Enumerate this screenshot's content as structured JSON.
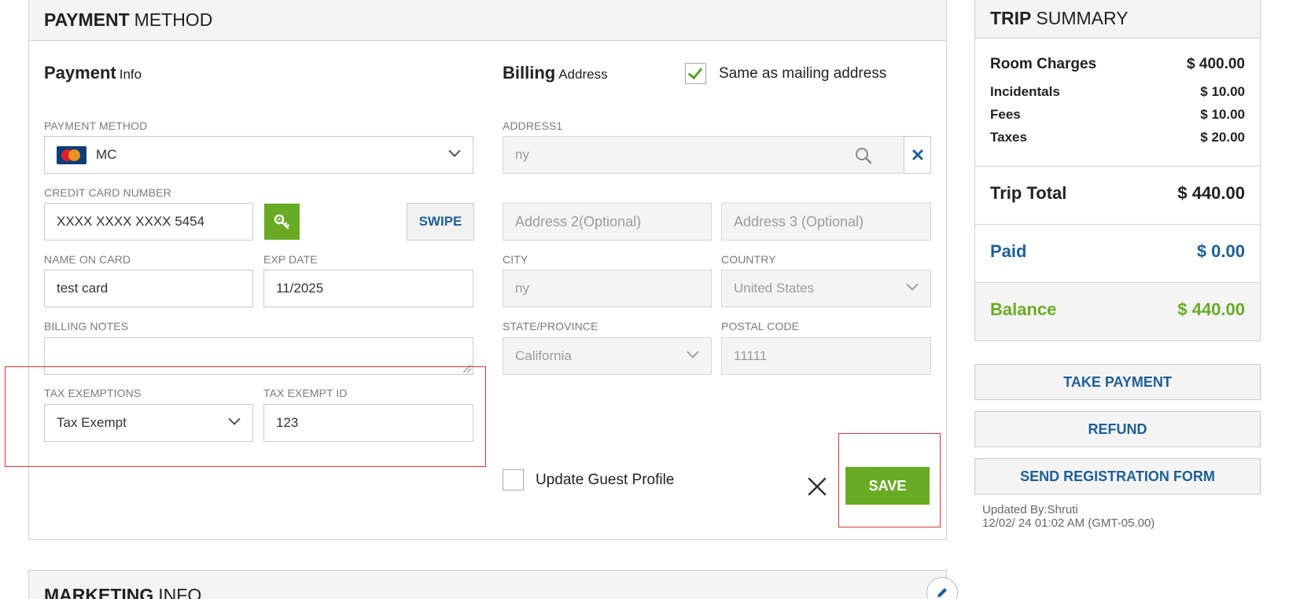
{
  "payment_panel": {
    "title_bold": "PAYMENT",
    "title_rest": "METHOD",
    "payment_info": {
      "title_bold": "Payment",
      "title_rest": "Info"
    },
    "billing_address": {
      "title_bold": "Billing",
      "title_rest": "Address"
    },
    "same_as_mailing": {
      "label": "Same as mailing address",
      "checked": true
    },
    "payment_method": {
      "label": "PAYMENT METHOD",
      "value": "MC",
      "icon": "mastercard-icon"
    },
    "credit_card": {
      "label": "CREDIT CARD NUMBER",
      "value": "XXXX XXXX XXXX 5454",
      "swipe_label": "SWIPE",
      "key_icon": "key-icon"
    },
    "name_on_card": {
      "label": "NAME ON CARD",
      "value": "test card"
    },
    "exp_date": {
      "label": "EXP DATE",
      "value": "11/2025"
    },
    "billing_notes": {
      "label": "BILLING NOTES",
      "value": ""
    },
    "tax_exemptions": {
      "label": "TAX EXEMPTIONS",
      "value": "Tax Exempt"
    },
    "tax_exempt_id": {
      "label": "TAX EXEMPT ID",
      "value": "123"
    },
    "address1": {
      "label": "ADDRESS1",
      "value": "ny"
    },
    "address2": {
      "placeholder": "Address 2(Optional)"
    },
    "address3": {
      "placeholder": "Address 3 (Optional)"
    },
    "city": {
      "label": "CITY",
      "value": "ny"
    },
    "country": {
      "label": "COUNTRY",
      "value": "United States"
    },
    "state": {
      "label": "STATE/PROVINCE",
      "value": "California"
    },
    "postal_code": {
      "label": "POSTAL CODE",
      "value": "11111"
    },
    "update_guest_profile": {
      "label": "Update Guest Profile",
      "checked": false
    },
    "save_label": "SAVE"
  },
  "marketing_panel": {
    "title_bold": "MARKETING",
    "title_rest": "INFO"
  },
  "trip_summary": {
    "title_bold": "TRIP",
    "title_rest": "SUMMARY",
    "room_charges": {
      "label": "Room Charges",
      "value": "$ 400.00"
    },
    "incidentals": {
      "label": "Incidentals",
      "value": "$ 10.00"
    },
    "fees": {
      "label": "Fees",
      "value": "$ 10.00"
    },
    "taxes": {
      "label": "Taxes",
      "value": "$ 20.00"
    },
    "trip_total": {
      "label": "Trip Total",
      "value": "$ 440.00"
    },
    "paid": {
      "label": "Paid",
      "value": "$ 0.00"
    },
    "balance": {
      "label": "Balance",
      "value": "$ 440.00"
    }
  },
  "actions": {
    "take_payment": "TAKE PAYMENT",
    "refund": "REFUND",
    "send_registration_form": "SEND REGISTRATION FORM"
  },
  "updated": {
    "by": "Updated By:Shruti",
    "at": "12/02/ 24 01:02 AM (GMT-05.00)"
  },
  "colors": {
    "accent_green": "#6aab26",
    "link_blue": "#1f5f96",
    "highlight_red": "#d9353c"
  }
}
